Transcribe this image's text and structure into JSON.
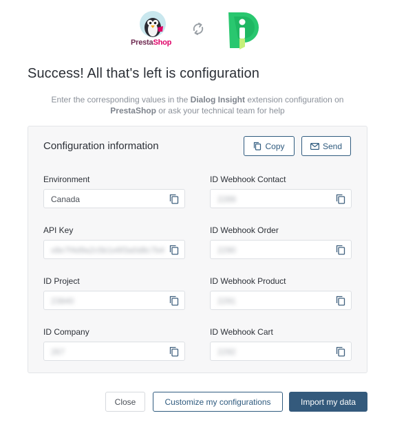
{
  "header": {
    "presta_logo": {
      "word_part1": "Presta",
      "word_part2": "Shop"
    },
    "sync_icon": "sync-icon",
    "dialog_insight_logo": "dialog-insight-logo"
  },
  "title": "Success! All that's left is configuration",
  "subtitle": {
    "part1": "Enter the corresponding values in the ",
    "strong1": "Dialog Insight",
    "part2": " extension configuration on ",
    "strong2": "PrestaShop",
    "part3": " or ask your technical team for help"
  },
  "config": {
    "title": "Configuration information",
    "copy_label": "Copy",
    "send_label": "Send",
    "fields_left": [
      {
        "label": "Environment",
        "value": "Canada",
        "blurred": false
      },
      {
        "label": "API Key",
        "value": "x8e7f4d9a2c5b1e6f3a0d8c7b4",
        "blurred": true
      },
      {
        "label": "ID Project",
        "value": "23840",
        "blurred": true
      },
      {
        "label": "ID Company",
        "value": "267",
        "blurred": true
      }
    ],
    "fields_right": [
      {
        "label": "ID Webhook Contact",
        "value": "2289",
        "blurred": true
      },
      {
        "label": "ID Webhook Order",
        "value": "2290",
        "blurred": true
      },
      {
        "label": "ID Webhook Product",
        "value": "2291",
        "blurred": true
      },
      {
        "label": "ID Webhook Cart",
        "value": "2292",
        "blurred": true
      }
    ]
  },
  "footer": {
    "close_label": "Close",
    "customize_label": "Customize my configurations",
    "import_label": "Import my data"
  },
  "colors": {
    "accent": "#2e5a7e",
    "primary_button": "#345a7c",
    "presta_purple": "#6e2a51",
    "presta_pink": "#df0067",
    "dialog_insight_green": "#29c76f"
  }
}
